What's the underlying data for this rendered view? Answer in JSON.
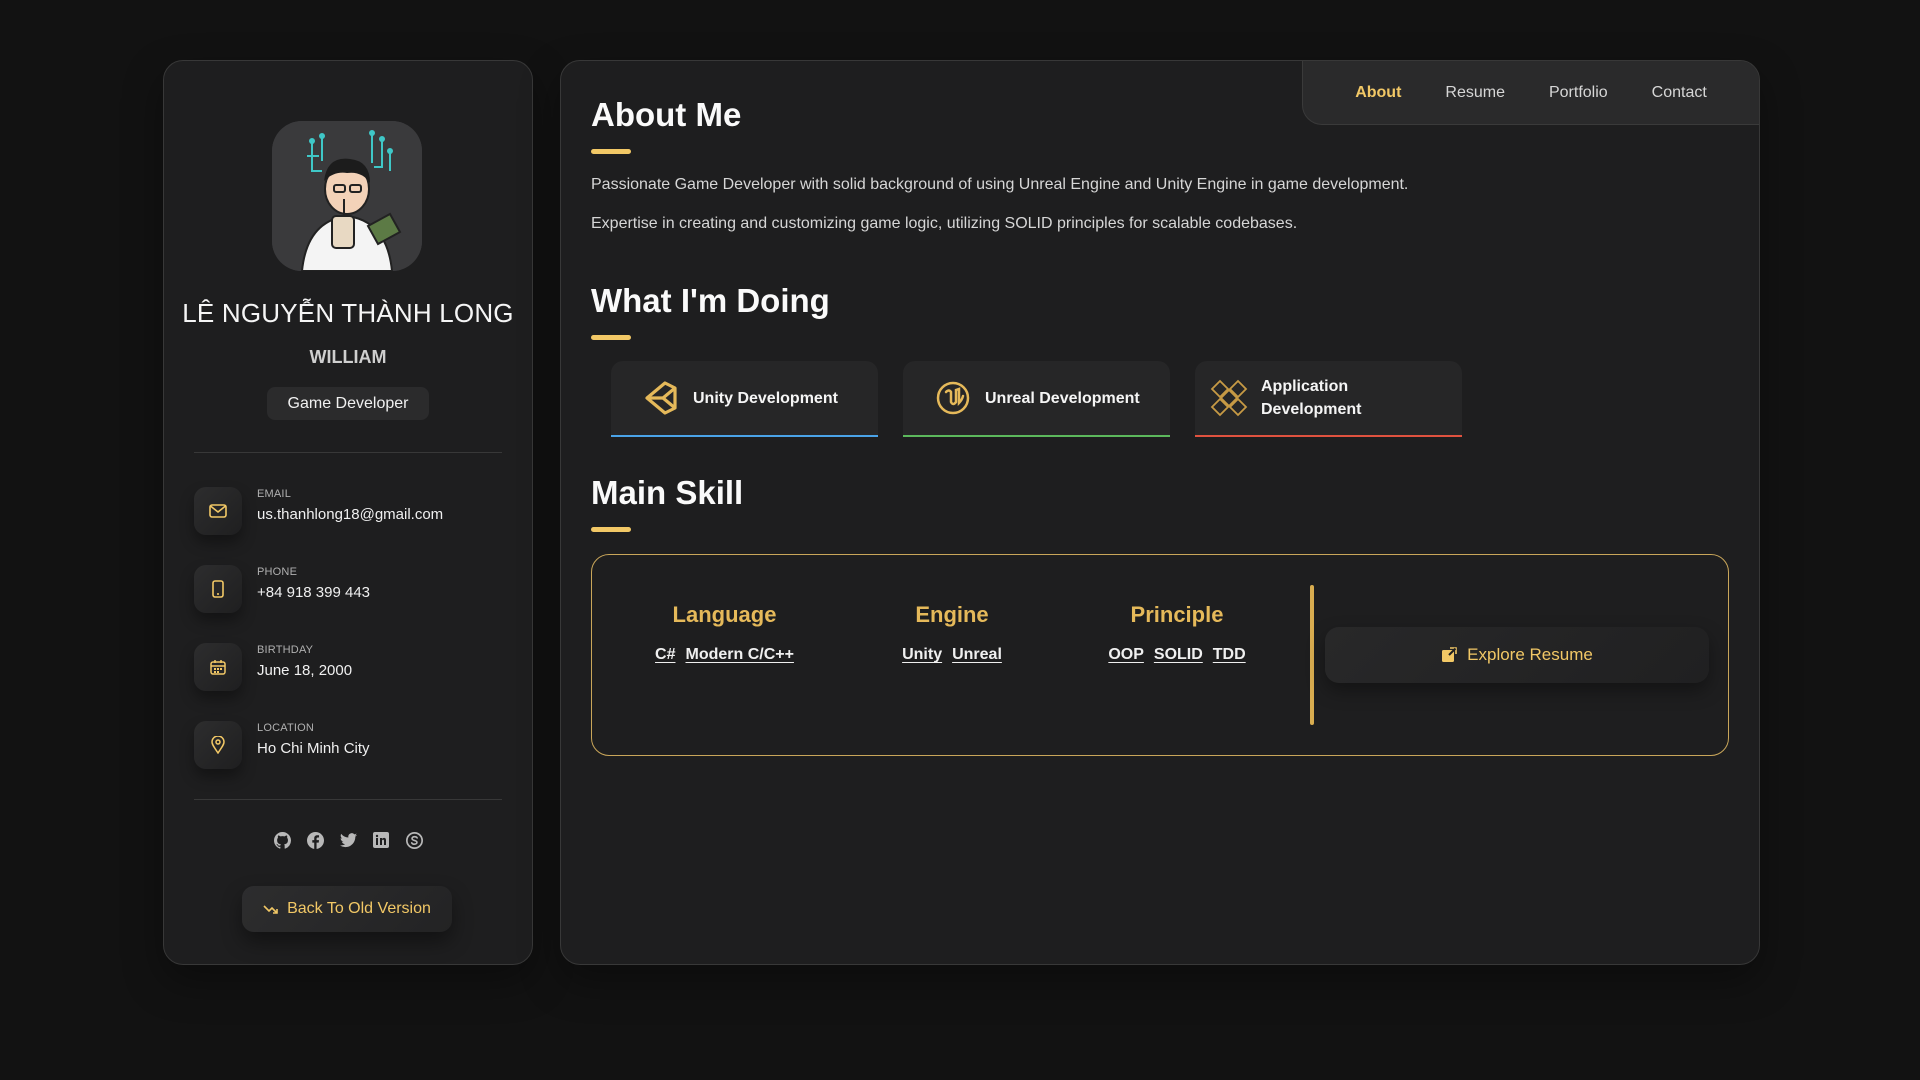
{
  "profile": {
    "name": "LÊ NGUYỄN THÀNH LONG",
    "nickname": "WILLIAM",
    "title": "Game Developer"
  },
  "contacts": [
    {
      "label": "EMAIL",
      "value": "us.thanhlong18@gmail.com",
      "icon": "mail-icon"
    },
    {
      "label": "PHONE",
      "value": "+84 918 399 443",
      "icon": "phone-icon"
    },
    {
      "label": "BIRTHDAY",
      "value": "June 18, 2000",
      "icon": "calendar-icon"
    },
    {
      "label": "LOCATION",
      "value": "Ho Chi Minh City",
      "icon": "location-pin-icon"
    }
  ],
  "socials": [
    "github-icon",
    "facebook-icon",
    "twitter-icon",
    "linkedin-icon",
    "skype-icon"
  ],
  "old_version_label": "Back To Old Version",
  "nav": {
    "items": [
      "About",
      "Resume",
      "Portfolio",
      "Contact"
    ],
    "active": "About"
  },
  "about": {
    "title": "About Me",
    "paragraphs": [
      "Passionate Game Developer with solid background of using Unreal Engine and Unity Engine in game development.",
      "Expertise in creating and customizing game logic, utilizing SOLID principles for scalable codebases."
    ]
  },
  "doing": {
    "title": "What I'm Doing",
    "services": [
      {
        "title": "Unity Development",
        "icon": "unity-logo-icon",
        "accent": "#4aa3e8"
      },
      {
        "title": "Unreal Development",
        "icon": "unreal-logo-icon",
        "accent": "#5cb85c"
      },
      {
        "title": "Application Development",
        "icon": "app-pattern-icon",
        "accent": "#e0523f"
      }
    ]
  },
  "skills": {
    "title": "Main Skill",
    "columns": [
      {
        "heading": "Language",
        "items": [
          "C#",
          "Modern C/C++"
        ]
      },
      {
        "heading": "Engine",
        "items": [
          "Unity",
          "Unreal"
        ]
      },
      {
        "heading": "Principle",
        "items": [
          "OOP",
          "SOLID",
          "TDD"
        ]
      }
    ],
    "explore_label": "Explore Resume"
  },
  "colors": {
    "accent": "#f2c866",
    "background": "#121212",
    "card": "#1e1e1f"
  }
}
